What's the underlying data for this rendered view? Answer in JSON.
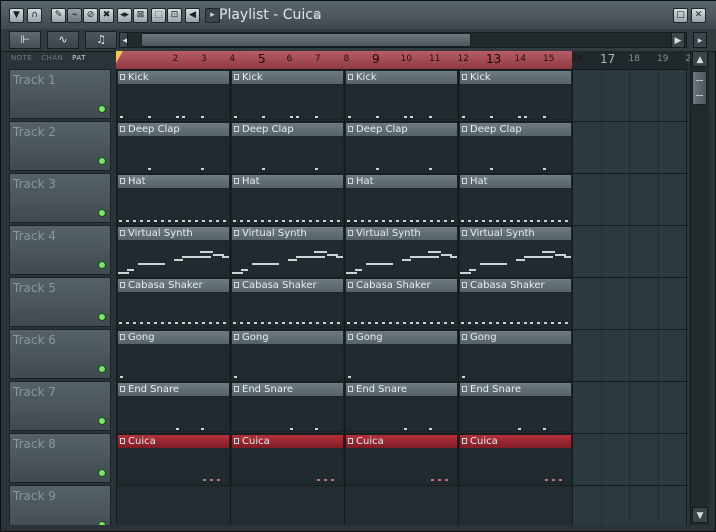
{
  "window": {
    "title": "Playlist - Cuica",
    "toolbar_left_icons": [
      "menu-arrow-icon",
      "magnet-icon",
      "pencil-icon",
      "brush-icon",
      "mute-icon",
      "slip-icon",
      "slice-icon",
      "select-icon",
      "zoom-icon",
      "speaker-icon"
    ],
    "window_buttons": [
      "restore-icon",
      "close-icon"
    ]
  },
  "modes": {
    "labels": [
      "NOTE",
      "CHAN",
      "PAT"
    ],
    "active": "PAT"
  },
  "ruler": {
    "bars": [
      "",
      "2",
      "3",
      "4",
      "5",
      "6",
      "7",
      "8",
      "9",
      "10",
      "11",
      "12",
      "13",
      "14",
      "15",
      "16",
      "17",
      "18",
      "19",
      "20"
    ],
    "major": [
      5,
      9,
      13,
      17
    ]
  },
  "tracks": [
    {
      "name": "Track 1"
    },
    {
      "name": "Track 2"
    },
    {
      "name": "Track 3"
    },
    {
      "name": "Track 4"
    },
    {
      "name": "Track 5"
    },
    {
      "name": "Track 6"
    },
    {
      "name": "Track 7"
    },
    {
      "name": "Track 8"
    },
    {
      "name": "Track 9"
    }
  ],
  "clips": [
    {
      "name": "Kick",
      "track": 0,
      "pattern": "kick"
    },
    {
      "name": "Deep Clap",
      "track": 1,
      "pattern": "clap"
    },
    {
      "name": "Hat",
      "track": 2,
      "pattern": "hat"
    },
    {
      "name": "Virtual Synth",
      "track": 3,
      "pattern": "synth"
    },
    {
      "name": "Cabasa Shaker",
      "track": 4,
      "pattern": "shaker"
    },
    {
      "name": "Gong",
      "track": 5,
      "pattern": "gong"
    },
    {
      "name": "End Snare",
      "track": 6,
      "pattern": "snare"
    },
    {
      "name": "Cuica",
      "track": 7,
      "pattern": "cuica",
      "selected": true
    }
  ],
  "colors": {
    "selected_clip": "#b3303a",
    "ruler_active": "#b85c66",
    "led": "#7ee26b"
  }
}
